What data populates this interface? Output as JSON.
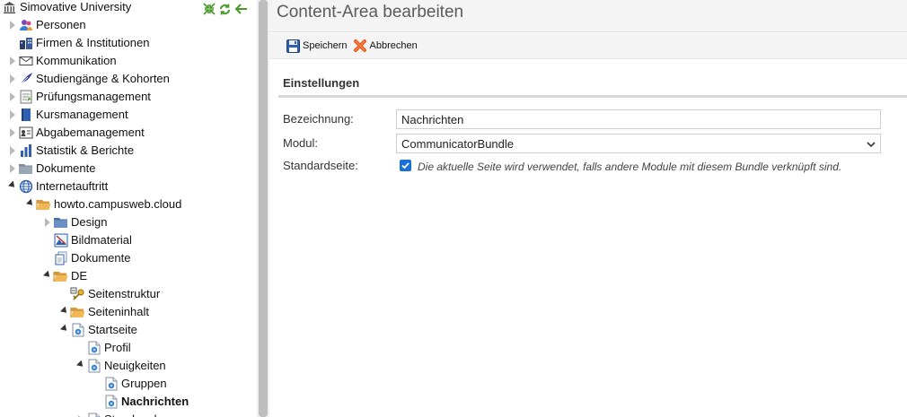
{
  "sidebar": {
    "tools": [
      {
        "icon": "collapse-all-icon"
      },
      {
        "icon": "refresh-icon"
      },
      {
        "icon": "back-arrow-icon"
      }
    ],
    "tree": [
      {
        "label": "Simovative University",
        "level": 0,
        "toggle": "none",
        "icon": "university-icon",
        "selected": false
      },
      {
        "label": "Personen",
        "level": 1,
        "toggle": "right",
        "icon": "people-icon",
        "selected": false
      },
      {
        "label": "Firmen & Institutionen",
        "level": 1,
        "toggle": "none",
        "icon": "buildings-icon",
        "selected": false
      },
      {
        "label": "Kommunikation",
        "level": 1,
        "toggle": "right",
        "icon": "envelope-icon",
        "selected": false
      },
      {
        "label": "Studiengänge & Kohorten",
        "level": 1,
        "toggle": "right",
        "icon": "feather-icon",
        "selected": false
      },
      {
        "label": "Prüfungsmanagement",
        "level": 1,
        "toggle": "right",
        "icon": "checklist-icon",
        "selected": false
      },
      {
        "label": "Kursmanagement",
        "level": 1,
        "toggle": "right",
        "icon": "book-icon",
        "selected": false
      },
      {
        "label": "Abgabemanagement",
        "level": 1,
        "toggle": "right",
        "icon": "id-card-icon",
        "selected": false
      },
      {
        "label": "Statistik & Berichte",
        "level": 1,
        "toggle": "right",
        "icon": "bar-chart-icon",
        "selected": false
      },
      {
        "label": "Dokumente",
        "level": 1,
        "toggle": "right",
        "icon": "folder-gray-icon",
        "selected": false
      },
      {
        "label": "Internetauftritt",
        "level": 1,
        "toggle": "down",
        "icon": "globe-icon",
        "selected": false
      },
      {
        "label": "howto.campusweb.cloud",
        "level": 2,
        "toggle": "down",
        "icon": "folder-open-icon",
        "selected": false
      },
      {
        "label": "Design",
        "level": 3,
        "toggle": "right",
        "icon": "folder-blue-icon",
        "selected": false
      },
      {
        "label": "Bildmaterial",
        "level": 3,
        "toggle": "none",
        "icon": "image-icon",
        "selected": false
      },
      {
        "label": "Dokumente",
        "level": 3,
        "toggle": "none",
        "icon": "documents-icon",
        "selected": false
      },
      {
        "label": "DE",
        "level": 3,
        "toggle": "down",
        "icon": "folder-open-icon",
        "selected": false
      },
      {
        "label": "Seitenstruktur",
        "level": 4,
        "toggle": "none",
        "icon": "key-icon",
        "selected": false
      },
      {
        "label": "Seiteninhalt",
        "level": 4,
        "toggle": "down",
        "icon": "folder-open-icon",
        "selected": false
      },
      {
        "label": "Startseite",
        "level": 5,
        "toggle": "down",
        "icon": "page-icon",
        "selected": false
      },
      {
        "label": "Profil",
        "level": 6,
        "toggle": "none",
        "icon": "page-icon",
        "selected": false
      },
      {
        "label": "Neuigkeiten",
        "level": 6,
        "toggle": "down",
        "icon": "page-icon",
        "selected": false
      },
      {
        "label": "Gruppen",
        "level": 7,
        "toggle": "none",
        "icon": "page-icon",
        "selected": false
      },
      {
        "label": "Nachrichten",
        "level": 7,
        "toggle": "none",
        "icon": "page-icon",
        "selected": true
      },
      {
        "label": "Stundenplan",
        "level": 6,
        "toggle": "right",
        "icon": "page-icon",
        "selected": false
      }
    ]
  },
  "header": {
    "title": "Content-Area bearbeiten"
  },
  "toolbar": {
    "save_label": "Speichern",
    "cancel_label": "Abbrechen"
  },
  "form": {
    "section_title": "Einstellungen",
    "name_label": "Bezeichnung:",
    "name_value": "Nachrichten",
    "module_label": "Modul:",
    "module_value": "CommunicatorBundle",
    "default_label": "Standardseite:",
    "default_checked": true,
    "default_hint": "Die aktuelle Seite wird verwendet, falls andere Module mit diesem Bundle verknüpft sind."
  }
}
